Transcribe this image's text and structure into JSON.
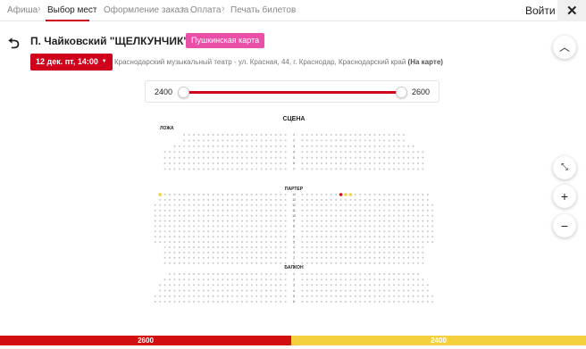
{
  "breadcrumbs": [
    {
      "label": "Афиша",
      "active": false
    },
    {
      "label": "Выбор мест",
      "active": true
    },
    {
      "label": "Оформление заказа",
      "active": false
    },
    {
      "label": "Оплата",
      "active": false
    },
    {
      "label": "Печать билетов",
      "active": false
    }
  ],
  "header": {
    "login_label": "Войти",
    "close_glyph": "✕"
  },
  "event": {
    "title": "П. Чайковский \"ЩЕЛКУНЧИК\"",
    "pushkin_label": "Пушкинская карта",
    "date_label": "12 дек. пт, 14:00",
    "venue": "Краснодарский музыкальный театр - ул. Красная, 44, г. Краснодар, Краснодарский край",
    "map_link": "(На карте)"
  },
  "price_filter": {
    "min_label": "2400",
    "max_label": "2600",
    "min": 2400,
    "max": 2600
  },
  "hall": {
    "stage_label": "СЦЕНА",
    "box_label": "ЛОЖА",
    "parterre_label": "ПАРТЕР",
    "balcony_label": "БАЛКОН",
    "parterre_row_numbers": [
      "14",
      "13",
      "12",
      "11",
      "10",
      "9",
      "8",
      "7",
      "6",
      "5",
      "4",
      "3",
      "2",
      "1"
    ],
    "box_row_numbers": [
      "1",
      "2",
      "3",
      "4",
      "5",
      "6",
      "7"
    ],
    "balcony_row_numbers": [
      "1",
      "2",
      "3",
      "4",
      "5",
      "6"
    ]
  },
  "legend": [
    {
      "label": "2600",
      "color": "#d10f0f"
    },
    {
      "label": "2400",
      "color": "#f4d03f"
    }
  ],
  "colors": {
    "accent": "#d0021b",
    "pushkin": "#e94fa6",
    "seat_free": "#c8c8c8",
    "seat_red": "#d10f0f",
    "seat_yellow": "#f4d03f"
  },
  "icons": {
    "back": "arrow-back-icon",
    "collapse": "chevron-up-icon",
    "fit": "fit-screen-icon",
    "zoom_in": "plus-icon",
    "zoom_out": "minus-icon"
  }
}
